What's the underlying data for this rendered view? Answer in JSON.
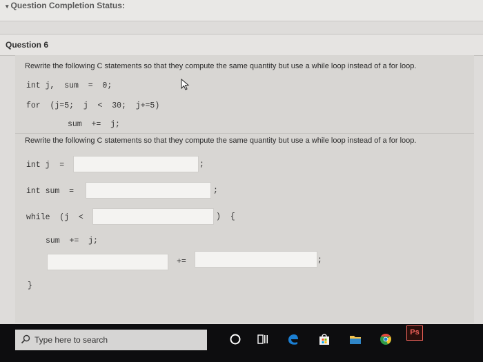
{
  "header": {
    "status_label": "Question Completion Status:"
  },
  "question": {
    "number_label": "Question 6",
    "instruction": "Rewrite the following C statements so that they compute the same quantity but use a while loop instead of a for loop.",
    "original_code": [
      "int j,  sum  =  0;",
      "for  (j=5;  j  <  30;  j+=5)",
      "sum  +=  j;"
    ],
    "instruction_repeat": "Rewrite the following C statements so that they compute the same quantity but use a while loop instead of a for loop.",
    "answer_template": {
      "line1_prefix": "int j  =",
      "line1_suffix": ";",
      "line2_prefix": "int sum  =",
      "line2_suffix": ";",
      "line3_prefix": "while  (j  <",
      "line3_suffix": ")  {",
      "line4": "sum  +=  j;",
      "line5_middle": "+=",
      "line5_suffix": ";",
      "closing_brace": "}"
    },
    "fields": {
      "j_init": "",
      "sum_init": "",
      "while_cond": "",
      "lhs": "",
      "rhs": ""
    }
  },
  "taskbar": {
    "search_placeholder": "Type here to search",
    "icons": [
      "cortana-icon",
      "task-view-icon",
      "edge-icon",
      "store-icon",
      "folder-icon",
      "chrome-icon",
      "photoshop-icon"
    ],
    "photoshop_label": "Ps"
  },
  "colors": {
    "page_bg": "#dedcda",
    "taskbar_bg": "#0d0d0f",
    "edge_blue": "#1b7fd3",
    "chrome_red": "#e8453c",
    "chrome_yellow": "#f6c02d",
    "chrome_green": "#2e9b48",
    "photoshop_red": "#f0625a"
  }
}
